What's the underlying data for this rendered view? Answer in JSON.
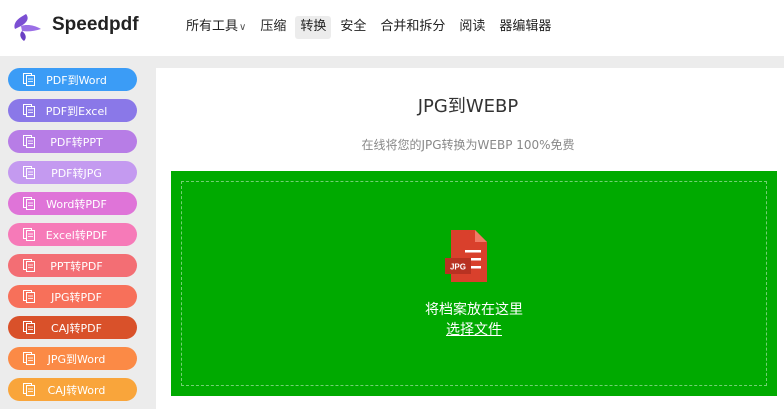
{
  "header": {
    "brand": "Speedpdf",
    "nav": [
      {
        "label": "所有工具",
        "has_dropdown": true,
        "active": false
      },
      {
        "label": "压缩",
        "active": false
      },
      {
        "label": "转换",
        "active": true
      },
      {
        "label": "安全",
        "active": false
      },
      {
        "label": "合并和拆分",
        "active": false
      },
      {
        "label": "阅读",
        "active": false
      },
      {
        "label": "器编辑器",
        "active": false
      }
    ]
  },
  "sidebar": {
    "items": [
      {
        "label": "PDF到Word",
        "color": "#3b9cf6"
      },
      {
        "label": "PDF到Excel",
        "color": "#8a78e8"
      },
      {
        "label": "PDF转PPT",
        "color": "#b77de6"
      },
      {
        "label": "PDF转JPG",
        "color": "#c49af0"
      },
      {
        "label": "Word转PDF",
        "color": "#df74d8"
      },
      {
        "label": "Excel转PDF",
        "color": "#f67ab8"
      },
      {
        "label": "PPT转PDF",
        "color": "#f36e74"
      },
      {
        "label": "JPG转PDF",
        "color": "#f7705a"
      },
      {
        "label": "CAJ转PDF",
        "color": "#d9512a"
      },
      {
        "label": "JPG到Word",
        "color": "#fb8a46"
      },
      {
        "label": "CAJ转Word",
        "color": "#f9a53b"
      }
    ]
  },
  "main": {
    "title": "JPG到WEBP",
    "subtitle": "在线将您的JPG转换为WEBP 100%免费",
    "dropzone": {
      "file_badge": "JPG",
      "drop_text": "将档案放在这里",
      "choose_label": "选择文件",
      "color": "#00aa00"
    }
  },
  "icons": {
    "logo": "speedpdf-logo",
    "nav_dropdown": "chevron-down-icon",
    "sidebar_item": "document-icon",
    "upload": "jpg-file-icon"
  }
}
